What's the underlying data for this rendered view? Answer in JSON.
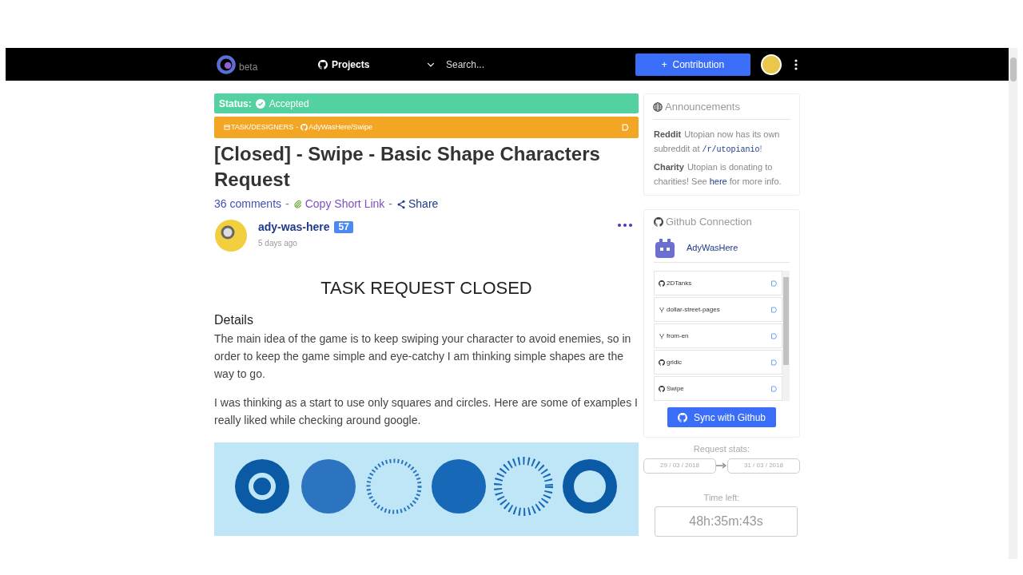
{
  "navbar": {
    "logo_text": "beta",
    "projects": "Projects",
    "search": {
      "placeholder": "Search..."
    },
    "contribution_button": "+  Contribution"
  },
  "status": {
    "label": "Status:",
    "value": "Accepted"
  },
  "category_bar": {
    "category": "TASK/DESIGNERS",
    "separator": "-",
    "repo": "AdyWasHere/Swipe"
  },
  "title": "[Closed] - Swipe - Basic Shape Characters Request",
  "meta": {
    "comments": "36 comments",
    "copy_link": "Copy Short Link",
    "share": "Share",
    "separator": "-"
  },
  "author": {
    "name": "ady-was-here",
    "reputation": "57",
    "time": "5 days ago"
  },
  "body": {
    "heading": "TASK REQUEST CLOSED",
    "subheading": "Details",
    "paragraphs": [
      "The main idea of the game is to keep swiping your character to avoid enemies, so in order to keep the game simple and eye-catchy I am thinking simple shapes are the way to go.",
      "I was thinking as a start to use only squares and circles. Here are some of examples I really liked while checking around google."
    ]
  },
  "announcements": {
    "title": "Announcements",
    "items": [
      {
        "label": "Reddit",
        "text": "Utopian now has its own subreddit at ",
        "code": "/r/utopianio",
        "after": "!"
      },
      {
        "label": "Charity",
        "text": "Utopian is donating to charities! See ",
        "link": "here",
        "after": " for more info."
      }
    ]
  },
  "github": {
    "title": "Github Connection",
    "user": "AdyWasHere",
    "repos": [
      {
        "kind": "repo",
        "name": "2DTanks"
      },
      {
        "kind": "fork",
        "name": "dollar-street-pages"
      },
      {
        "kind": "fork",
        "name": "from-en"
      },
      {
        "kind": "repo",
        "name": "gridic"
      },
      {
        "kind": "repo",
        "name": "Swipe"
      }
    ],
    "sync_button": "Sync with Github"
  },
  "request_stats": {
    "label": "Request stats:",
    "start": "29 / 03 / 2018",
    "end": "31 / 03 / 2018"
  },
  "time_left": {
    "label": "Time left:",
    "value": "48h:35m:43s"
  }
}
